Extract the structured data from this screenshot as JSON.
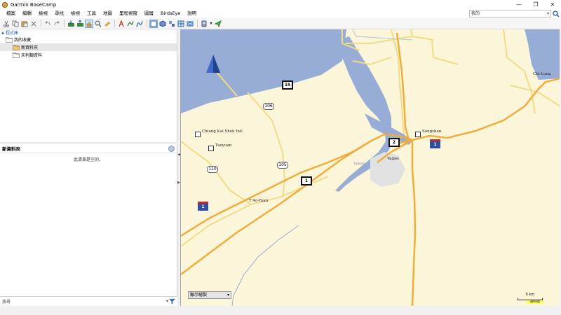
{
  "window": {
    "title": "Garmin BaseCamp",
    "minimize": "—",
    "maximize": "❐",
    "close": "✕"
  },
  "menu": [
    "檔案",
    "編輯",
    "檢視",
    "尋找",
    "檢視",
    "工具",
    "地圖",
    "里程視窗",
    "圖層",
    "BirdsEye",
    "說明"
  ],
  "search": {
    "value": "我的",
    "dropdown": "▾",
    "icon": "magnifier-icon"
  },
  "library": {
    "header": "程式庫",
    "items": [
      {
        "label": "我的收藏",
        "level": 0
      },
      {
        "label": "新資料夾",
        "level": 1,
        "selected": true
      },
      {
        "label": "未判類資料",
        "level": 1
      }
    ]
  },
  "new_data": {
    "title": "新資料夾",
    "empty_text": "此清單是空的。"
  },
  "filter": {
    "placeholder": "搜尋",
    "dropdown": "▾"
  },
  "map": {
    "shields": {
      "hwy15": "15",
      "hwy106": "106",
      "hwy110": "110",
      "hwy105": "105",
      "fwy1a": "1",
      "fwy2": "2",
      "nat1a": "1",
      "nat1b": "1"
    },
    "places": {
      "chiang": "Chiang Kai Shek Intl",
      "taoyuan_air": "Taoyuan",
      "taoyuan": "T'Ao-Yuan",
      "taipei": "Taipei",
      "songshan": "Songshan",
      "chilung": "Chi-Lung",
      "lake": "Tamsui"
    },
    "map_select": "顯示繪製",
    "scale_text": "5 km",
    "scale_note": "國際地圖"
  },
  "colors": {
    "water": "#98add6",
    "land": "#fbf6d9",
    "highway": "#f0ac3c",
    "minor_road": "#f1dc86",
    "urban": "#e1e1e1",
    "selection": "#cfe3f7"
  }
}
